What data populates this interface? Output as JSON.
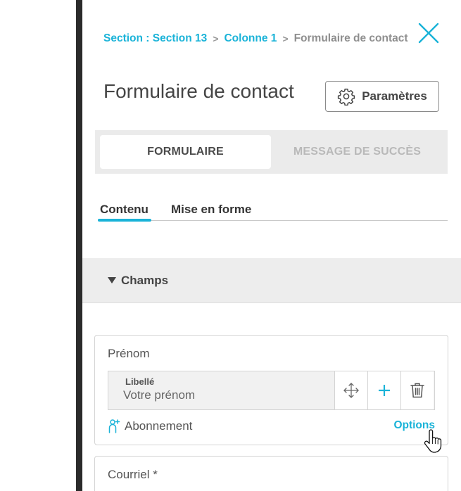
{
  "breadcrumb": {
    "items": [
      "Section : Section 13",
      "Colonne 1"
    ],
    "separator": ">",
    "current": "Formulaire de contact"
  },
  "panel": {
    "title": "Formulaire de contact",
    "settings_button": "Paramètres"
  },
  "tabs": [
    {
      "label": "FORMULAIRE",
      "active": true
    },
    {
      "label": "MESSAGE DE SUCCÈS",
      "active": false
    }
  ],
  "subtabs": [
    {
      "label": "Contenu",
      "active": true
    },
    {
      "label": "Mise en forme",
      "active": false
    }
  ],
  "section": {
    "title": "Champs",
    "expanded": true
  },
  "fields": [
    {
      "name": "Prénom",
      "label_caption": "Libellé",
      "label_value": "Votre prénom",
      "subscription_label": "Abonnement",
      "options_link": "Options"
    },
    {
      "name": "Courriel *"
    }
  ],
  "colors": {
    "accent": "#1ab3d8",
    "tab_bg": "#ebebeb",
    "section_bg": "#ededed",
    "divider": "#2b2b2b"
  },
  "icons": {
    "close": "close-icon",
    "settings": "gear-icon",
    "move": "move-icon",
    "add": "plus-icon",
    "delete": "trash-icon",
    "subscription": "person-plus-icon",
    "cursor": "hand-cursor-icon"
  }
}
